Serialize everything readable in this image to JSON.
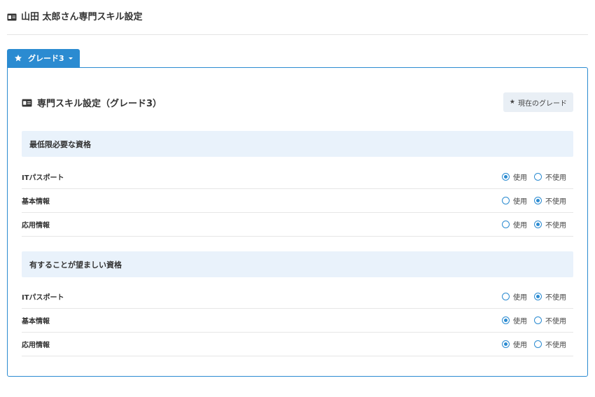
{
  "header": {
    "title": "山田 太郎さん専門スキル設定"
  },
  "tab": {
    "label": "グレード3"
  },
  "panel": {
    "title": "専門スキル設定（グレード3）",
    "current_grade_label": "現在のグレード"
  },
  "option_labels": {
    "use": "使用",
    "not_use": "不使用"
  },
  "sections": [
    {
      "title": "最低限必要な資格",
      "rows": [
        {
          "label": "ITパスポート",
          "selected": "use"
        },
        {
          "label": "基本情報",
          "selected": "not_use"
        },
        {
          "label": "応用情報",
          "selected": "not_use"
        }
      ]
    },
    {
      "title": "有することが望ましい資格",
      "rows": [
        {
          "label": "ITパスポート",
          "selected": "not_use"
        },
        {
          "label": "基本情報",
          "selected": "use"
        },
        {
          "label": "応用情報",
          "selected": "use"
        }
      ]
    }
  ],
  "colors": {
    "accent": "#2b8bd1",
    "section_bg": "#e9f2fb"
  }
}
